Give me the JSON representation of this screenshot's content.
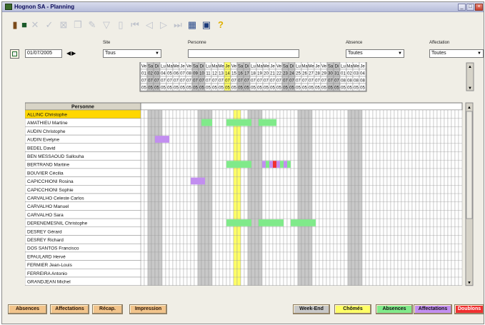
{
  "window": {
    "title": "Hognon SA - Planning"
  },
  "filters": {
    "date": "01/07/2005",
    "site": {
      "label": "Site",
      "value": "Tous"
    },
    "personne": {
      "label": "Personne",
      "value": ""
    },
    "absence": {
      "label": "Absence",
      "value": "Toutes"
    },
    "affectation": {
      "label": "Affectation",
      "value": "Toutes"
    }
  },
  "calendar": {
    "days": [
      "Ve",
      "Sa",
      "Di",
      "Lu",
      "Ma",
      "Me",
      "Je",
      "Ve",
      "Sa",
      "Di",
      "Lu",
      "Ma",
      "Me",
      "Je",
      "Ve",
      "Sa",
      "Di",
      "Lu",
      "Ma",
      "Me",
      "Je",
      "Ve",
      "Sa",
      "Di",
      "Lu",
      "Ma",
      "Me",
      "Je",
      "Ve",
      "Sa",
      "Di",
      "Lu",
      "Ma",
      "Me",
      "Je"
    ],
    "dates": [
      "01",
      "02",
      "03",
      "04",
      "05",
      "06",
      "07",
      "08",
      "09",
      "10",
      "11",
      "12",
      "13",
      "14",
      "15",
      "16",
      "17",
      "18",
      "19",
      "20",
      "21",
      "22",
      "23",
      "24",
      "25",
      "26",
      "27",
      "28",
      "29",
      "30",
      "31",
      "01",
      "02",
      "03",
      "04"
    ],
    "months": [
      "07",
      "07",
      "07",
      "07",
      "07",
      "07",
      "07",
      "07",
      "07",
      "07",
      "07",
      "07",
      "07",
      "07",
      "07",
      "07",
      "07",
      "07",
      "07",
      "07",
      "07",
      "07",
      "07",
      "07",
      "07",
      "07",
      "07",
      "07",
      "07",
      "07",
      "07",
      "08",
      "08",
      "08",
      "08"
    ],
    "years": [
      "05",
      "05",
      "05",
      "05",
      "05",
      "05",
      "05",
      "05",
      "05",
      "05",
      "05",
      "05",
      "05",
      "05",
      "05",
      "05",
      "05",
      "05",
      "05",
      "05",
      "05",
      "05",
      "05",
      "05",
      "05",
      "05",
      "05",
      "05",
      "05",
      "05",
      "05",
      "05",
      "05",
      "05",
      "05"
    ]
  },
  "people_header": "Personne",
  "people": [
    "ALLINC Christophe",
    "AMATHIEU Martine",
    "AUDIN Christophe",
    "AUDIN Evelyne",
    "BEDEL David",
    "BEN MESSAOUD Sallouha",
    "BERTRAND Martine",
    "BOUVIER Cécilia",
    "CAPICCHIONI Rosina",
    "CAPICCHIONI Sophie",
    "CARVALHO Celeste Carlos",
    "CARVALHO Manuel",
    "CARVALHO Sara",
    "DERENEMESNIL Christophe",
    "DESREY Gérard",
    "DESREY Richard",
    "DOS SANTOS Francisco",
    "EPAULARD Hervé",
    "FERMIER Jean-Louis",
    "FERREIRA Antonio",
    "GRANDJEAN Michel"
  ],
  "selected_person": 0,
  "highlight_day": 13,
  "bars": [
    {
      "row": 1,
      "from": 17,
      "to": 19,
      "status": "absences"
    },
    {
      "row": 1,
      "from": 24,
      "to": 30,
      "status": "absences"
    },
    {
      "row": 1,
      "from": 33,
      "to": 37,
      "status": "absences"
    },
    {
      "row": 3,
      "from": 4,
      "to": 7,
      "status": "affectations"
    },
    {
      "row": 6,
      "from": 24,
      "to": 30,
      "status": "absences"
    },
    {
      "row": 6,
      "from": 34,
      "to": 34,
      "status": "affectations"
    },
    {
      "row": 6,
      "from": 35,
      "to": 35,
      "status": "absences"
    },
    {
      "row": 6,
      "from": 36,
      "to": 36,
      "status": "affectations"
    },
    {
      "row": 6,
      "from": 37,
      "to": 37,
      "status": "doublons"
    },
    {
      "row": 6,
      "from": 38,
      "to": 38,
      "status": "affectations"
    },
    {
      "row": 6,
      "from": 39,
      "to": 39,
      "status": "absences"
    },
    {
      "row": 6,
      "from": 40,
      "to": 40,
      "status": "affectations"
    },
    {
      "row": 6,
      "from": 41,
      "to": 41,
      "status": "absences"
    },
    {
      "row": 8,
      "from": 14,
      "to": 17,
      "status": "affectations"
    },
    {
      "row": 13,
      "from": 24,
      "to": 30,
      "status": "absences"
    },
    {
      "row": 13,
      "from": 33,
      "to": 39,
      "status": "absences"
    },
    {
      "row": 13,
      "from": 42,
      "to": 48,
      "status": "absences"
    }
  ],
  "buttons": {
    "absences": "Absences",
    "affectations": "Affectations",
    "recap": "Récap.",
    "impression": "Impression"
  },
  "legend": [
    {
      "label": "Week-End",
      "color": "#c8c8c8"
    },
    {
      "label": "Chômés",
      "color": "#ffff66"
    },
    {
      "label": "Absences",
      "color": "#80ea8a"
    },
    {
      "label": "Affectations",
      "color": "#c28ef0"
    },
    {
      "label": "Doublons",
      "color": "#f03030"
    }
  ],
  "colors": {
    "week_end": "#c8c8c8",
    "chomes": "#ffff66",
    "absences": "#80ea8a",
    "affectations": "#c28ef0",
    "doublons": "#f03030",
    "selected": "#ffd700"
  }
}
